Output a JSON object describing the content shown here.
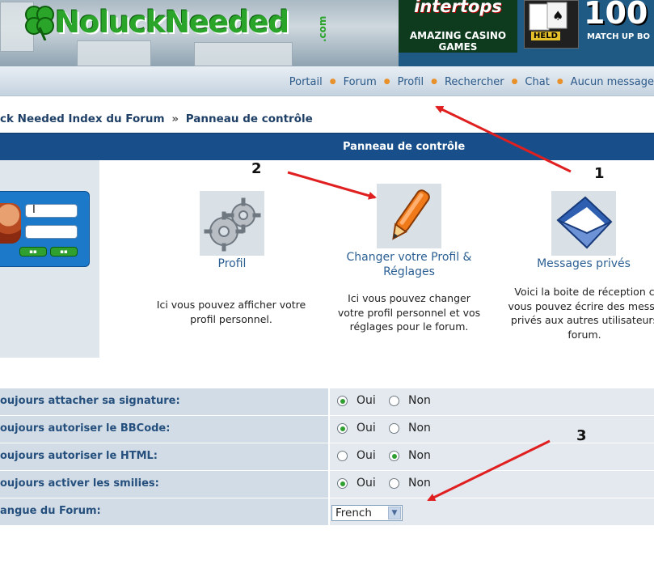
{
  "banner": {
    "logo_text": "NoluckNeeded",
    "logo_suffix": ".com",
    "ad": {
      "brand": "intertops",
      "line1": "AMAZING CASINO",
      "line2": "GAMES",
      "held": "HELD",
      "big": "100",
      "small": "MATCH UP BO"
    }
  },
  "nav": {
    "items": [
      "Portail",
      "Forum",
      "Profil",
      "Rechercher",
      "Chat",
      "Aucun message"
    ]
  },
  "breadcrumb": {
    "home": "ck Needed Index du Forum",
    "separator": "»",
    "current": "Panneau de contrôle"
  },
  "control_panel": {
    "title": "Panneau de contrôle",
    "tiles": [
      {
        "label": "Profil",
        "description": [
          "Ici vous pouvez afficher votre",
          "profil personnel."
        ]
      },
      {
        "label_lines": [
          "Changer votre Profil &",
          "Réglages"
        ],
        "description": [
          "Ici vous pouvez changer",
          "votre profil personnel et vos",
          "réglages pour le forum."
        ]
      },
      {
        "label": "Messages privés",
        "description": [
          "Voici la boite de réception c",
          "vous pouvez écrire des messa",
          "privés aux autres utilisateurs",
          "forum."
        ]
      }
    ]
  },
  "preferences": {
    "rows": [
      {
        "label": "oujours attacher sa signature:",
        "yes": "Oui",
        "no": "Non",
        "selected": "yes"
      },
      {
        "label": "oujours autoriser le BBCode:",
        "yes": "Oui",
        "no": "Non",
        "selected": "yes"
      },
      {
        "label": "oujours autoriser le HTML:",
        "yes": "Oui",
        "no": "Non",
        "selected": "no"
      },
      {
        "label": "oujours activer les smilies:",
        "yes": "Oui",
        "no": "Non",
        "selected": "yes"
      }
    ],
    "language": {
      "label": "angue du Forum:",
      "value": "French"
    }
  },
  "annotations": {
    "n1": "1",
    "n2": "2",
    "n3": "3"
  },
  "colors": {
    "arrow": "#e02020",
    "header": "#184f8a",
    "nav_separator": "#e8902a",
    "radio_on": "#2fa02f"
  }
}
